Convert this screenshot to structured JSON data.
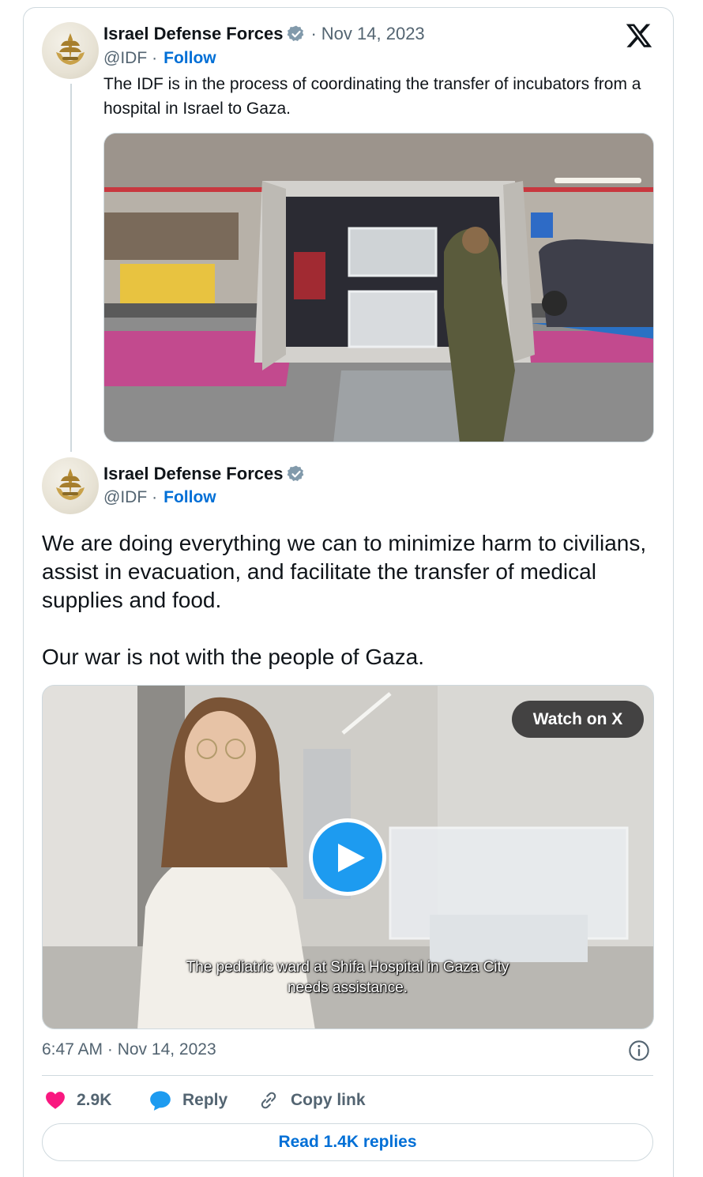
{
  "quoted_tweet": {
    "author_name": "Israel Defense Forces",
    "date_sep": "·",
    "date": "Nov 14, 2023",
    "handle": "@IDF",
    "handle_sep": "·",
    "follow_label": "Follow",
    "text": "The IDF is in the process of coordinating the transfer of incubators from a hospital in Israel to Gaza."
  },
  "main_tweet": {
    "author_name": "Israel Defense Forces",
    "handle": "@IDF",
    "handle_sep": "·",
    "follow_label": "Follow",
    "paragraphs": [
      "We are doing everything we can to minimize harm to civilians, assist in evacuation, and facilitate the transfer of medical supplies and food.",
      "Our war is not with the people of Gaza."
    ],
    "video": {
      "watch_label": "Watch on X",
      "caption_line1": "The pediatric ward at Shifa Hospital in Gaza City",
      "caption_line2": "needs assistance."
    },
    "timestamp": "6:47 AM · Nov 14, 2023"
  },
  "actions": {
    "likes": "2.9K",
    "reply_label": "Reply",
    "copy_link_label": "Copy link",
    "read_replies_label": "Read 1.4K replies"
  },
  "icons": {
    "brand": "x-logo-icon",
    "verified": "verified-badge-icon",
    "avatar": "idf-emblem-icon",
    "like": "heart-icon",
    "reply": "speech-bubble-icon",
    "copy_link": "link-icon",
    "info": "info-icon",
    "play": "play-icon"
  },
  "colors": {
    "link_blue": "#006fd6",
    "verified_gray": "#829aab",
    "like_pink": "#f91880",
    "reply_blue": "#1d9bf0",
    "muted_text": "#536471",
    "border": "#cfd9de"
  }
}
